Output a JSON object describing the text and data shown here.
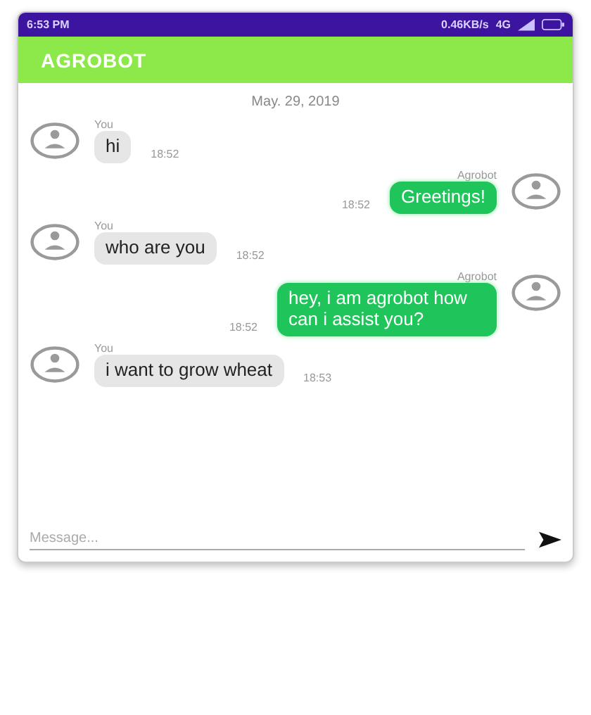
{
  "status_bar": {
    "time": "6:53 PM",
    "speed": "0.46KB/s",
    "network": "4G"
  },
  "app_bar": {
    "title": "AGROBOT"
  },
  "date": "May. 29, 2019",
  "messages": [
    {
      "kind": "user",
      "author": "You",
      "text": "hi",
      "time": "18:52"
    },
    {
      "kind": "bot",
      "author": "Agrobot",
      "text": "Greetings!",
      "time": "18:52"
    },
    {
      "kind": "user",
      "author": "You",
      "text": "who are you",
      "time": "18:52"
    },
    {
      "kind": "bot",
      "author": "Agrobot",
      "text": "hey, i am agrobot how can i assist you?",
      "time": "18:52"
    },
    {
      "kind": "user",
      "author": "You",
      "text": "i want to grow wheat",
      "time": "18:53"
    }
  ],
  "composer": {
    "placeholder": "Message..."
  }
}
